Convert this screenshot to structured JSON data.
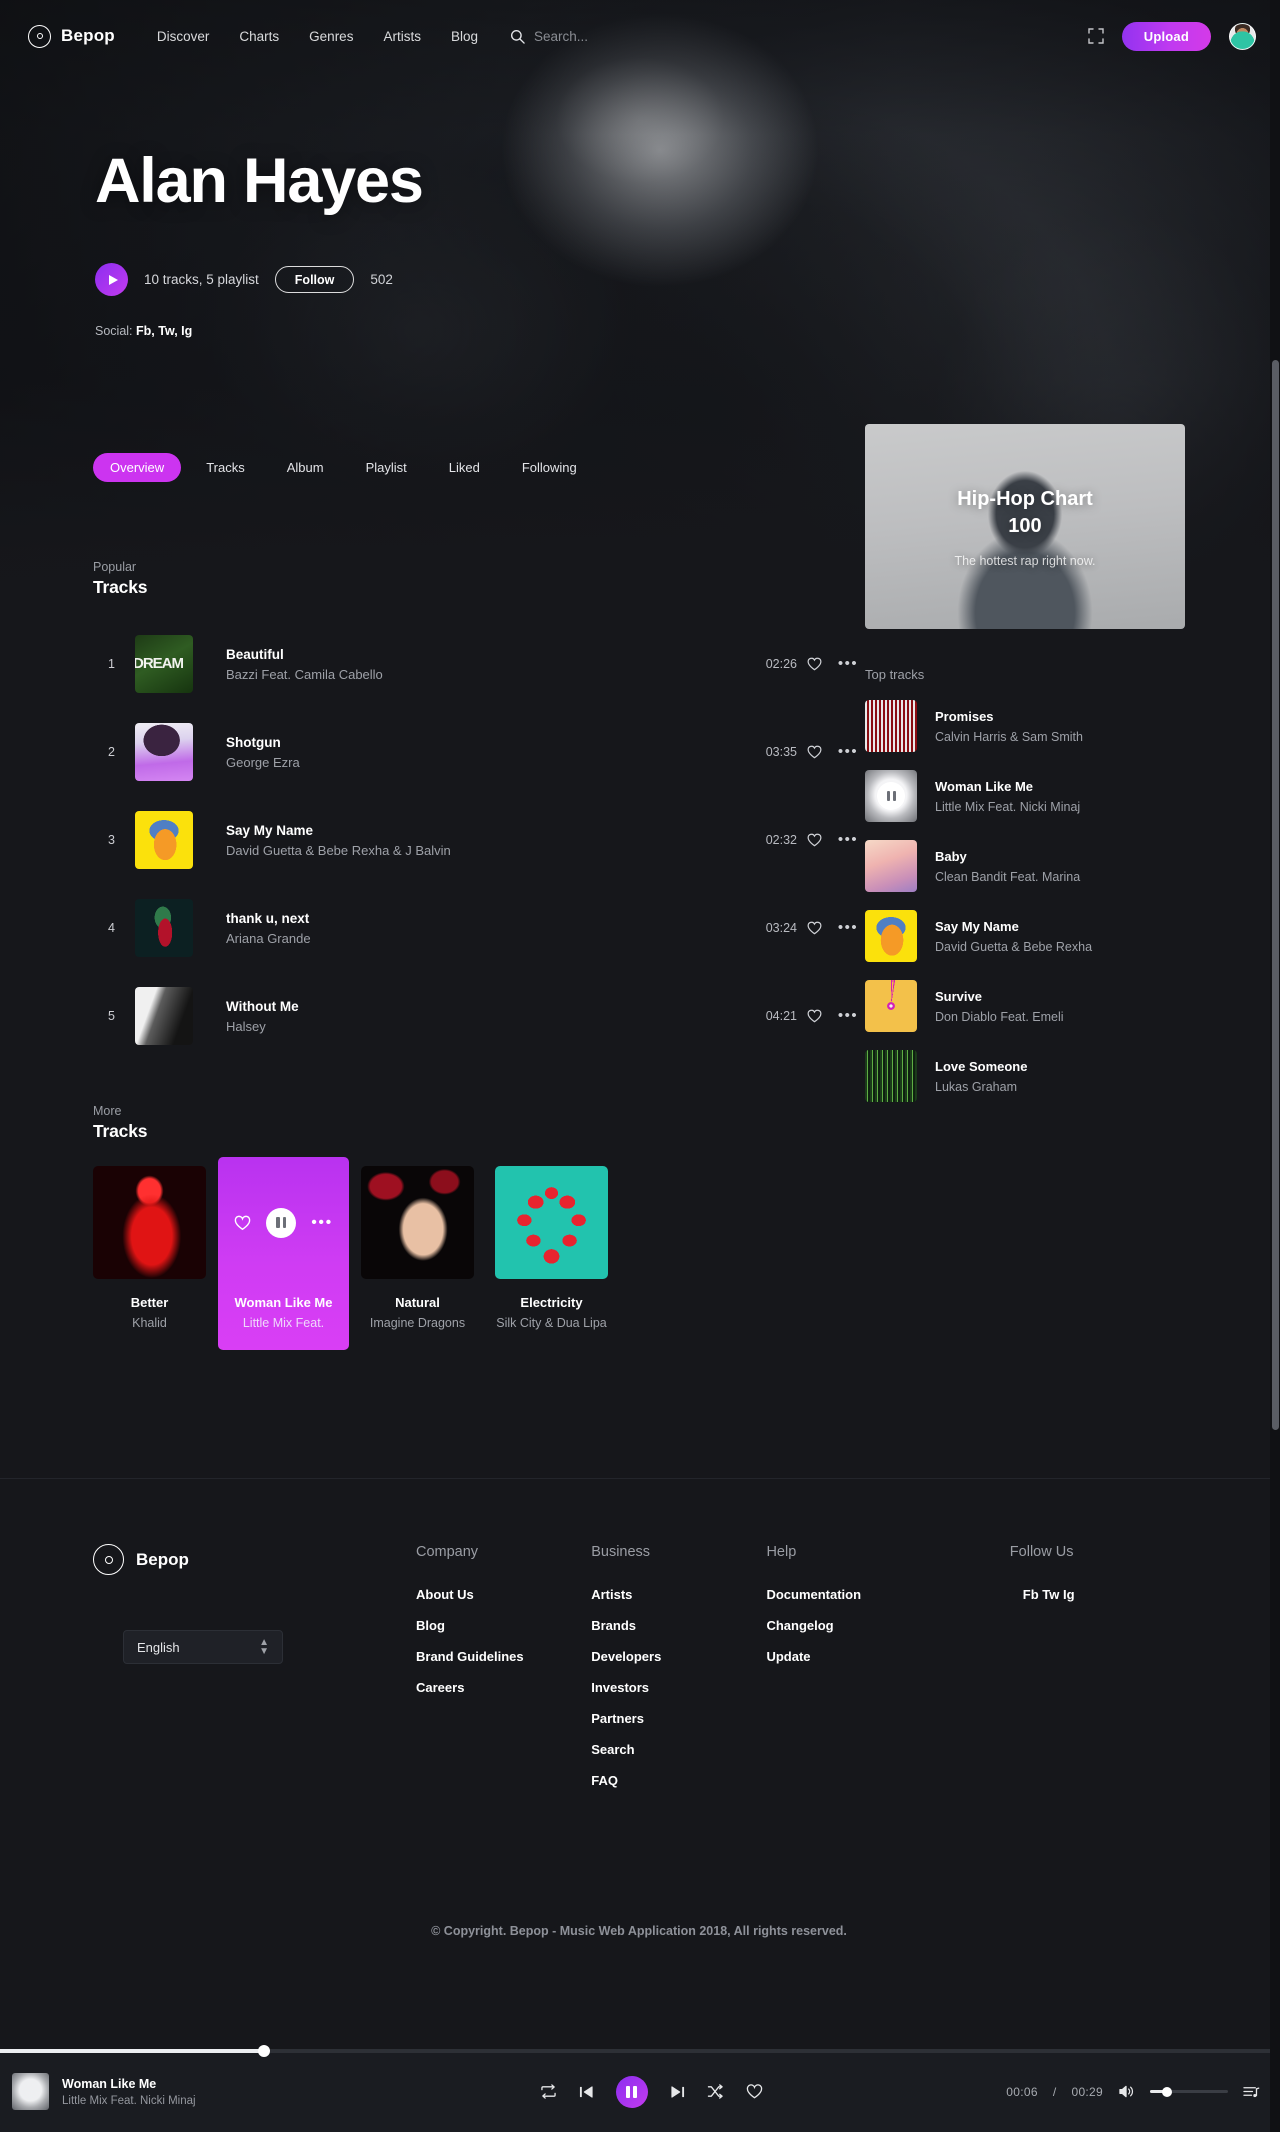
{
  "nav": {
    "brand": "Bepop",
    "brand_icon": "vinyl-record-icon",
    "links": [
      "Discover",
      "Charts",
      "Genres",
      "Artists",
      "Blog"
    ],
    "search_placeholder": "Search...",
    "search_value": "",
    "search_icon": "search-icon",
    "expand_icon": "fullscreen-icon",
    "upload_label": "Upload",
    "avatar_alt": "user-avatar"
  },
  "hero": {
    "artist": "Alan Hayes",
    "play_icon": "play-icon",
    "stats": "10 tracks, 5 playlist",
    "follow_label": "Follow",
    "follower_count": "502",
    "social_label": "Social:",
    "social_links": "Fb, Tw, Ig"
  },
  "tabs": [
    {
      "label": "Overview",
      "active": true
    },
    {
      "label": "Tracks",
      "active": false
    },
    {
      "label": "Album",
      "active": false
    },
    {
      "label": "Playlist",
      "active": false
    },
    {
      "label": "Liked",
      "active": false
    },
    {
      "label": "Following",
      "active": false
    }
  ],
  "popular": {
    "kicker": "Popular",
    "title": "Tracks",
    "rows": [
      {
        "num": "1",
        "title": "Beautiful",
        "artist": "Bazzi Feat. Camila Cabello",
        "time": "02:26",
        "art": "art-dream"
      },
      {
        "num": "2",
        "title": "Shotgun",
        "artist": "George Ezra",
        "time": "03:35",
        "art": "art-shotgun"
      },
      {
        "num": "3",
        "title": "Say My Name",
        "artist": "David Guetta & Bebe Rexha & J Balvin",
        "time": "02:32",
        "art": "art-yellow"
      },
      {
        "num": "4",
        "title": "thank u, next",
        "artist": "Ariana Grande",
        "time": "03:24",
        "art": "art-thank"
      },
      {
        "num": "5",
        "title": "Without Me",
        "artist": "Halsey",
        "time": "04:21",
        "art": "art-without"
      }
    ]
  },
  "more": {
    "kicker": "More",
    "title": "Tracks",
    "cards": [
      {
        "title": "Better",
        "artist": "Khalid",
        "art": "art-better",
        "active": false
      },
      {
        "title": "Woman Like Me",
        "artist": "Little Mix Feat.",
        "art": "art-wlm-card",
        "active": true
      },
      {
        "title": "Natural",
        "artist": "Imagine Dragons",
        "art": "art-natural",
        "active": false
      },
      {
        "title": "Electricity",
        "artist": "Silk City & Dua Lipa",
        "art": "art-electric",
        "active": false
      }
    ]
  },
  "chart_card": {
    "title_line1": "Hip-Hop Chart",
    "title_line2": "100",
    "subtitle": "The hottest rap right now."
  },
  "top_tracks": {
    "heading": "Top tracks",
    "rows": [
      {
        "title": "Promises",
        "artist": "Calvin Harris & Sam Smith",
        "art": "art-promises",
        "playing": false
      },
      {
        "title": "Woman Like Me",
        "artist": "Little Mix Feat. Nicki Minaj",
        "art": "art-woman",
        "playing": true
      },
      {
        "title": "Baby",
        "artist": "Clean Bandit Feat. Marina",
        "art": "art-baby",
        "playing": false
      },
      {
        "title": "Say My Name",
        "artist": "David Guetta & Bebe Rexha",
        "art": "art-yellow",
        "playing": false
      },
      {
        "title": "Survive",
        "artist": "Don Diablo Feat. Emeli",
        "art": "art-survive",
        "playing": false
      },
      {
        "title": "Love Someone",
        "artist": "Lukas Graham",
        "art": "art-love",
        "playing": false
      }
    ]
  },
  "footer": {
    "brand": "Bepop",
    "language": "English",
    "columns": [
      {
        "heading": "Company",
        "links": [
          "About Us",
          "Blog",
          "Brand Guidelines",
          "Careers"
        ]
      },
      {
        "heading": "Business",
        "links": [
          "Artists",
          "Brands",
          "Developers",
          "Investors",
          "Partners",
          "Search",
          "FAQ"
        ]
      },
      {
        "heading": "Help",
        "links": [
          "Documentation",
          "Changelog",
          "Update"
        ]
      }
    ],
    "follow_heading": "Follow Us",
    "follow_links": "Fb Tw Ig",
    "copyright": "© Copyright. Bepop - Music Web Application 2018, All rights reserved."
  },
  "player": {
    "track_title": "Woman Like Me",
    "track_artist": "Little Mix Feat. Nicki Minaj",
    "repeat_icon": "repeat-icon",
    "prev_icon": "previous-track-icon",
    "play_icon": "pause-icon",
    "next_icon": "next-track-icon",
    "shuffle_icon": "shuffle-icon",
    "like_icon": "heart-icon",
    "current_time": "00:06",
    "separator": "/",
    "total_time": "00:29",
    "volume_icon": "volume-icon",
    "queue_icon": "playlist-queue-icon",
    "progress_percent": "20.6",
    "volume_percent": "22"
  },
  "colors": {
    "accent": "#cc34f0",
    "accent_gradient_start": "#9333f0",
    "accent_gradient_end": "#d43ae8",
    "background": "#16171b",
    "panel": "#1a1c21",
    "muted_text": "#9ea1a8"
  }
}
